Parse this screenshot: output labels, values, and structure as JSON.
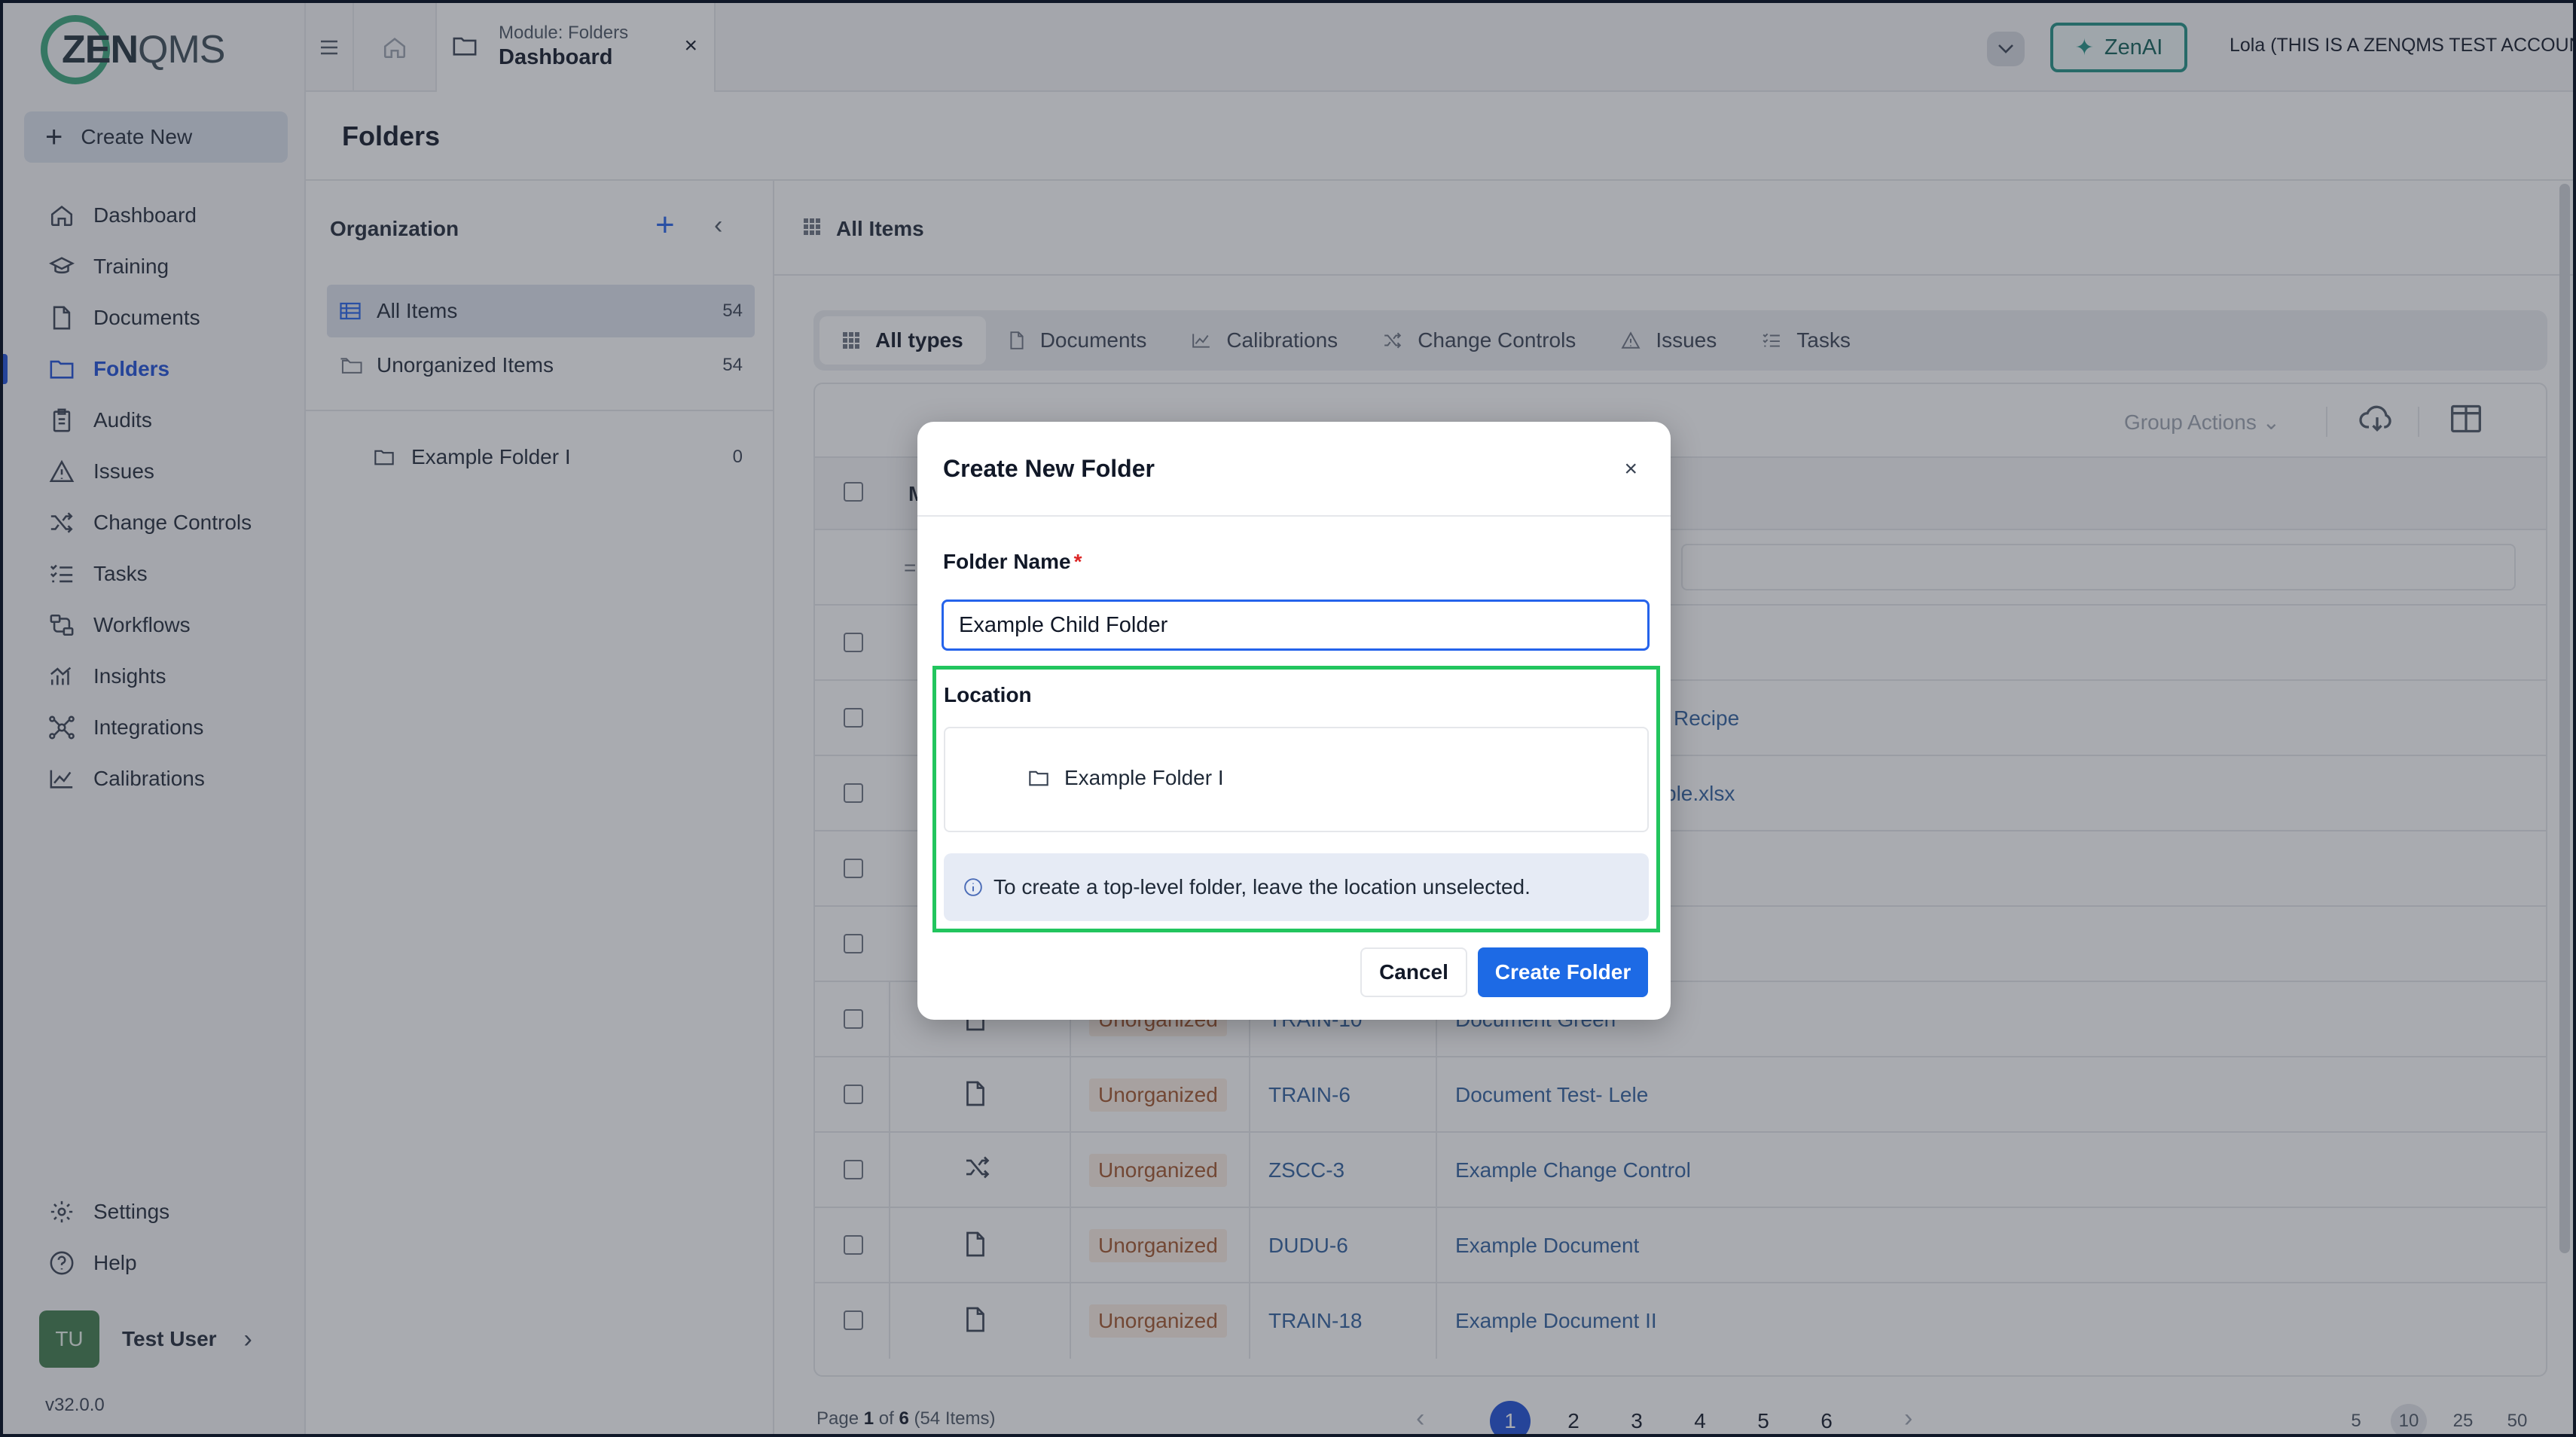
{
  "brand": {
    "logo_main": "ZEN",
    "logo_suffix": "QMS",
    "accent": "#1d4ed8"
  },
  "sidebar": {
    "create_new": "Create New",
    "items": [
      {
        "label": "Dashboard",
        "icon": "home-icon"
      },
      {
        "label": "Training",
        "icon": "graduation-cap-icon"
      },
      {
        "label": "Documents",
        "icon": "document-icon"
      },
      {
        "label": "Folders",
        "icon": "folder-icon",
        "active": true
      },
      {
        "label": "Audits",
        "icon": "clipboard-icon"
      },
      {
        "label": "Issues",
        "icon": "warning-icon"
      },
      {
        "label": "Change Controls",
        "icon": "shuffle-icon"
      },
      {
        "label": "Tasks",
        "icon": "task-list-icon"
      },
      {
        "label": "Workflows",
        "icon": "workflow-icon"
      },
      {
        "label": "Insights",
        "icon": "insights-icon"
      },
      {
        "label": "Integrations",
        "icon": "integrations-icon"
      },
      {
        "label": "Calibrations",
        "icon": "chart-icon"
      }
    ],
    "bottom_items": [
      {
        "label": "Settings",
        "icon": "gear-icon"
      },
      {
        "label": "Help",
        "icon": "help-icon"
      }
    ],
    "user": {
      "initials": "TU",
      "name": "Test User"
    },
    "version": "v32.0.0"
  },
  "topbar": {
    "tab_sub": "Module: Folders",
    "tab_main": "Dashboard",
    "tab_close": "×",
    "zenai_label": "ZenAI",
    "account": "Lola (THIS IS A ZENQMS TEST ACCOUNT)"
  },
  "page": {
    "title": "Folders"
  },
  "org_panel": {
    "title": "Organization",
    "rows": [
      {
        "label": "All Items",
        "count": "54"
      },
      {
        "label": "Unorganized Items",
        "count": "54"
      }
    ],
    "folders": [
      {
        "label": "Example Folder I",
        "count": "0"
      }
    ]
  },
  "main": {
    "title": "All Items",
    "type_tabs": [
      "All types",
      "Documents",
      "Calibrations",
      "Change Controls",
      "Issues",
      "Tasks"
    ],
    "group_actions": "Group Actions",
    "header_partial": "M",
    "partial_links": [
      "Recipe",
      "ple.xlsx"
    ],
    "rows": [
      {
        "icon": "document-icon",
        "status": "Unorganized",
        "code": "TRAIN-10",
        "title": "Document Green"
      },
      {
        "icon": "document-icon",
        "status": "Unorganized",
        "code": "TRAIN-6",
        "title": "Document Test- Lele"
      },
      {
        "icon": "shuffle-icon",
        "status": "Unorganized",
        "code": "ZSCC-3",
        "title": "Example Change Control"
      },
      {
        "icon": "document-icon",
        "status": "Unorganized",
        "code": "DUDU-6",
        "title": "Example Document"
      },
      {
        "icon": "document-icon",
        "status": "Unorganized",
        "code": "TRAIN-18",
        "title": "Example Document II"
      }
    ],
    "pager": {
      "prefix": "Page ",
      "current": "1",
      "of_text": " of ",
      "total": "6",
      "items": " (54 Items)",
      "pages": [
        "1",
        "2",
        "3",
        "4",
        "5",
        "6"
      ],
      "page_sizes": [
        "5",
        "10",
        "25",
        "50"
      ]
    }
  },
  "modal": {
    "title": "Create New Folder",
    "close": "×",
    "name_label": "Folder Name",
    "required_mark": "*",
    "name_value": "Example Child Folder",
    "location_label": "Location",
    "location_item": "Example Folder I",
    "info": "To create a top-level folder, leave the location unselected.",
    "cancel": "Cancel",
    "create": "Create Folder"
  }
}
